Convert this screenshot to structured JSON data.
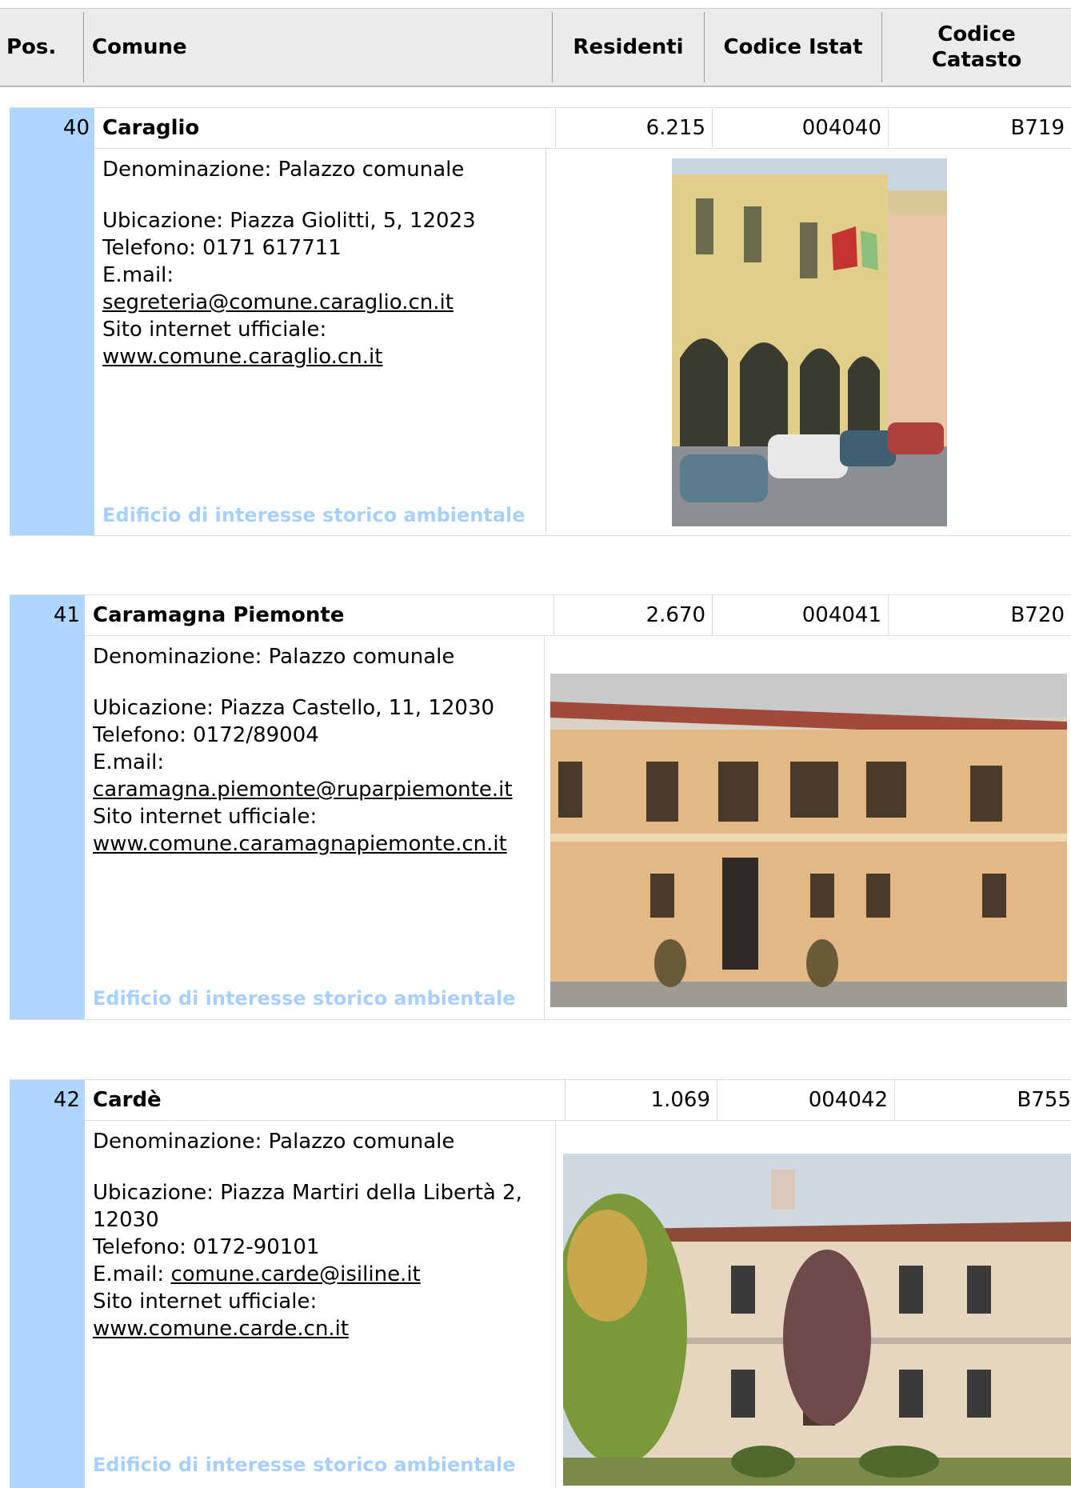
{
  "header": {
    "pos": "Pos.",
    "comune": "Comune",
    "residenti": "Residenti",
    "codice_istat": "Codice Istat",
    "codice_catasto": "Codice Catasto"
  },
  "records": [
    {
      "pos": "40",
      "name": "Caraglio",
      "residenti": "6.215",
      "istat": "004040",
      "catasto": "B719",
      "denominazione": "Denominazione: Palazzo comunale",
      "ubicazione": "Ubicazione: Piazza Giolitti, 5, 12023",
      "telefono": "Telefono: 0171 617711",
      "email_label": "E.mail:",
      "email": "segreteria@comune.caraglio.cn.it",
      "sito_label": "Sito internet ufficiale:",
      "sito": "www.comune.caraglio.cn.it",
      "note": "Edificio di interesse storico ambientale"
    },
    {
      "pos": "41",
      "name": "Caramagna Piemonte",
      "residenti": "2.670",
      "istat": "004041",
      "catasto": "B720",
      "denominazione": "Denominazione: Palazzo comunale",
      "ubicazione": "Ubicazione: Piazza Castello, 11, 12030",
      "telefono": "Telefono: 0172/89004",
      "email_label": "E.mail:",
      "email": "caramagna.piemonte@ruparpiemonte.it",
      "sito_label": "Sito internet ufficiale:",
      "sito": "www.comune.caramagnapiemonte.cn.it",
      "note": "Edificio di interesse storico ambientale"
    },
    {
      "pos": "42",
      "name": "Cardè",
      "residenti": "1.069",
      "istat": "004042",
      "catasto": "B755",
      "denominazione": "Denominazione: Palazzo comunale",
      "ubicazione_1": "Ubicazione: Piazza Martiri della Libertà 2,",
      "ubicazione_2": "12030",
      "telefono": "Telefono: 0172-90101",
      "email_label": "E.mail:",
      "email": "comune.carde@isiline.it",
      "sito_label": "Sito internet ufficiale:",
      "sito": "www.comune.carde.cn.it",
      "note": "Edificio di interesse storico ambientale"
    }
  ],
  "colors": {
    "header_bg": "#ebebeb",
    "pos_bg": "#aed6ff",
    "note_text": "#a8d0ff"
  }
}
